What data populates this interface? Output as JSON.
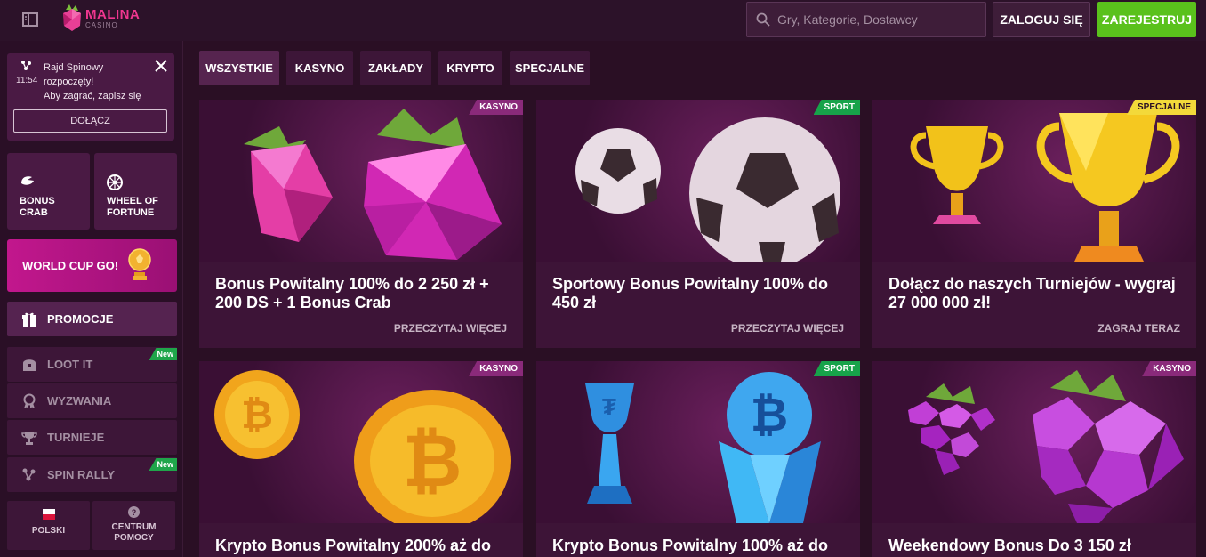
{
  "header": {
    "logo_text": "MALINA",
    "logo_sub": "CASINO",
    "search_placeholder": "Gry, Kategorie, Dostawcy",
    "login_label": "ZALOGUJ SIĘ",
    "register_label": "ZAREJESTRUJ"
  },
  "notification": {
    "time": "11:54",
    "line1": "Rajd Spinowy",
    "line2": "rozpoczęty!",
    "line3": "Aby zagrać, zapisz się",
    "button": "DOŁĄCZ"
  },
  "sidebar": {
    "tiles": [
      {
        "label_line1": "BONUS",
        "label_line2": "CRAB",
        "icon": "crab-icon"
      },
      {
        "label_line1": "WHEEL OF",
        "label_line2": "FORTUNE",
        "icon": "wheel-icon"
      }
    ],
    "worldcup": "WORLD CUP GO!",
    "nav": [
      {
        "label": "PROMOCJE",
        "icon": "gift-icon",
        "active": true,
        "new": false
      },
      {
        "label": "LOOT IT",
        "icon": "treasure-icon",
        "active": false,
        "new": true
      },
      {
        "label": "WYZWANIA",
        "icon": "medal-icon",
        "active": false,
        "new": false
      },
      {
        "label": "TURNIEJE",
        "icon": "trophy-icon",
        "active": false,
        "new": false
      },
      {
        "label": "SPIN RALLY",
        "icon": "rally-icon",
        "active": false,
        "new": true
      }
    ],
    "new_label": "New",
    "language": "POLSKI",
    "help_line1": "CENTRUM",
    "help_line2": "POMOCY"
  },
  "tabs": [
    {
      "label": "WSZYSTKIE",
      "active": true
    },
    {
      "label": "KASYNO",
      "active": false
    },
    {
      "label": "ZAKŁADY",
      "active": false
    },
    {
      "label": "KRYPTO",
      "active": false
    },
    {
      "label": "SPECJALNE",
      "active": false
    }
  ],
  "cards": [
    {
      "badge": "KASYNO",
      "title": "Bonus Powitalny 100% do 2 250 zł + 200 DS + 1 Bonus Crab",
      "cta": "PRZECZYTAJ WIĘCEJ",
      "art": "raspberry"
    },
    {
      "badge": "SPORT",
      "title": "Sportowy Bonus Powitalny 100% do 450 zł",
      "cta": "PRZECZYTAJ WIĘCEJ",
      "art": "football"
    },
    {
      "badge": "SPECJALNE",
      "title": "Dołącz do naszych Turniejów - wygraj 27 000 000 zł!",
      "cta": "ZAGRAJ TERAZ",
      "art": "trophy"
    },
    {
      "badge": "KASYNO",
      "title": "Krypto Bonus Powitalny 200% aż do",
      "cta": "",
      "art": "bitcoin"
    },
    {
      "badge": "SPORT",
      "title": "Krypto Bonus Powitalny 100% aż do",
      "cta": "",
      "art": "crypto-trophy"
    },
    {
      "badge": "KASYNO",
      "title": "Weekendowy Bonus Do 3 150 zł",
      "cta": "",
      "art": "grapes"
    }
  ],
  "colors": {
    "accent_pink": "#f0368f",
    "register_green": "#5ac11c",
    "sport_green": "#17a34a",
    "special_yellow": "#f3d93a"
  }
}
